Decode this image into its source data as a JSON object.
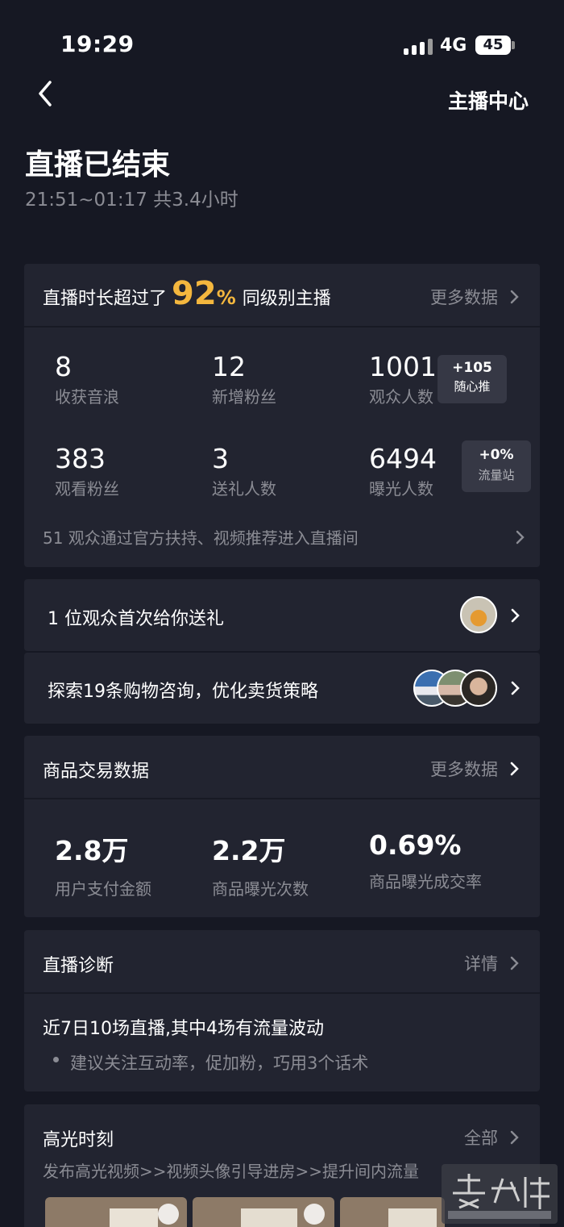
{
  "status_bar": {
    "time": "19:29",
    "network": "4G",
    "battery": "45"
  },
  "header": {
    "right_link": "主播中心"
  },
  "live": {
    "title": "直播已结束",
    "time_range": "21:51~01:17  共3.4小时"
  },
  "summary": {
    "prefix": "直播时长超过了",
    "highlight": "92",
    "pct": "%",
    "suffix": "同级别主播",
    "more": "更多数据",
    "stats": [
      {
        "value": "8",
        "label": "收获音浪"
      },
      {
        "value": "12",
        "label": "新增粉丝"
      },
      {
        "value": "1001",
        "label": "观众人数",
        "badge_top": "+105",
        "badge_bottom": "随心推"
      },
      {
        "value": "383",
        "label": "观看粉丝"
      },
      {
        "value": "3",
        "label": "送礼人数"
      },
      {
        "value": "6494",
        "label": "曝光人数",
        "badge_top": "+0%",
        "badge_bottom": "流量站"
      }
    ],
    "footer": "51 观众通过官方扶持、视频推荐进入直播间"
  },
  "gift_row": {
    "text": "1 位观众首次给你送礼"
  },
  "shop_row": {
    "text": "探索19条购物咨询，优化卖货策略"
  },
  "trade": {
    "title": "商品交易数据",
    "more": "更多数据",
    "stats": [
      {
        "value": "2.8万",
        "label": "用户支付金额"
      },
      {
        "value": "2.2万",
        "label": "商品曝光次数"
      },
      {
        "value": "0.69%",
        "label": "商品曝光成交率"
      }
    ]
  },
  "diagnosis": {
    "title": "直播诊断",
    "more": "详情",
    "headline": "近7日10场直播,其中4场有流量波动",
    "tip": "建议关注互动率，促加粉，巧用3个话术"
  },
  "highlights": {
    "title": "高光时刻",
    "more": "全部",
    "desc": "发布高光视频>>视频头像引导进房>>提升间内流量"
  },
  "icons": [
    "back-icon",
    "chevron-right-icon",
    "signal-icon",
    "play-icon"
  ],
  "colors": {
    "background": "#161823",
    "card": "#222430",
    "accent": "#f4b73e",
    "muted": "#8b8c94"
  }
}
